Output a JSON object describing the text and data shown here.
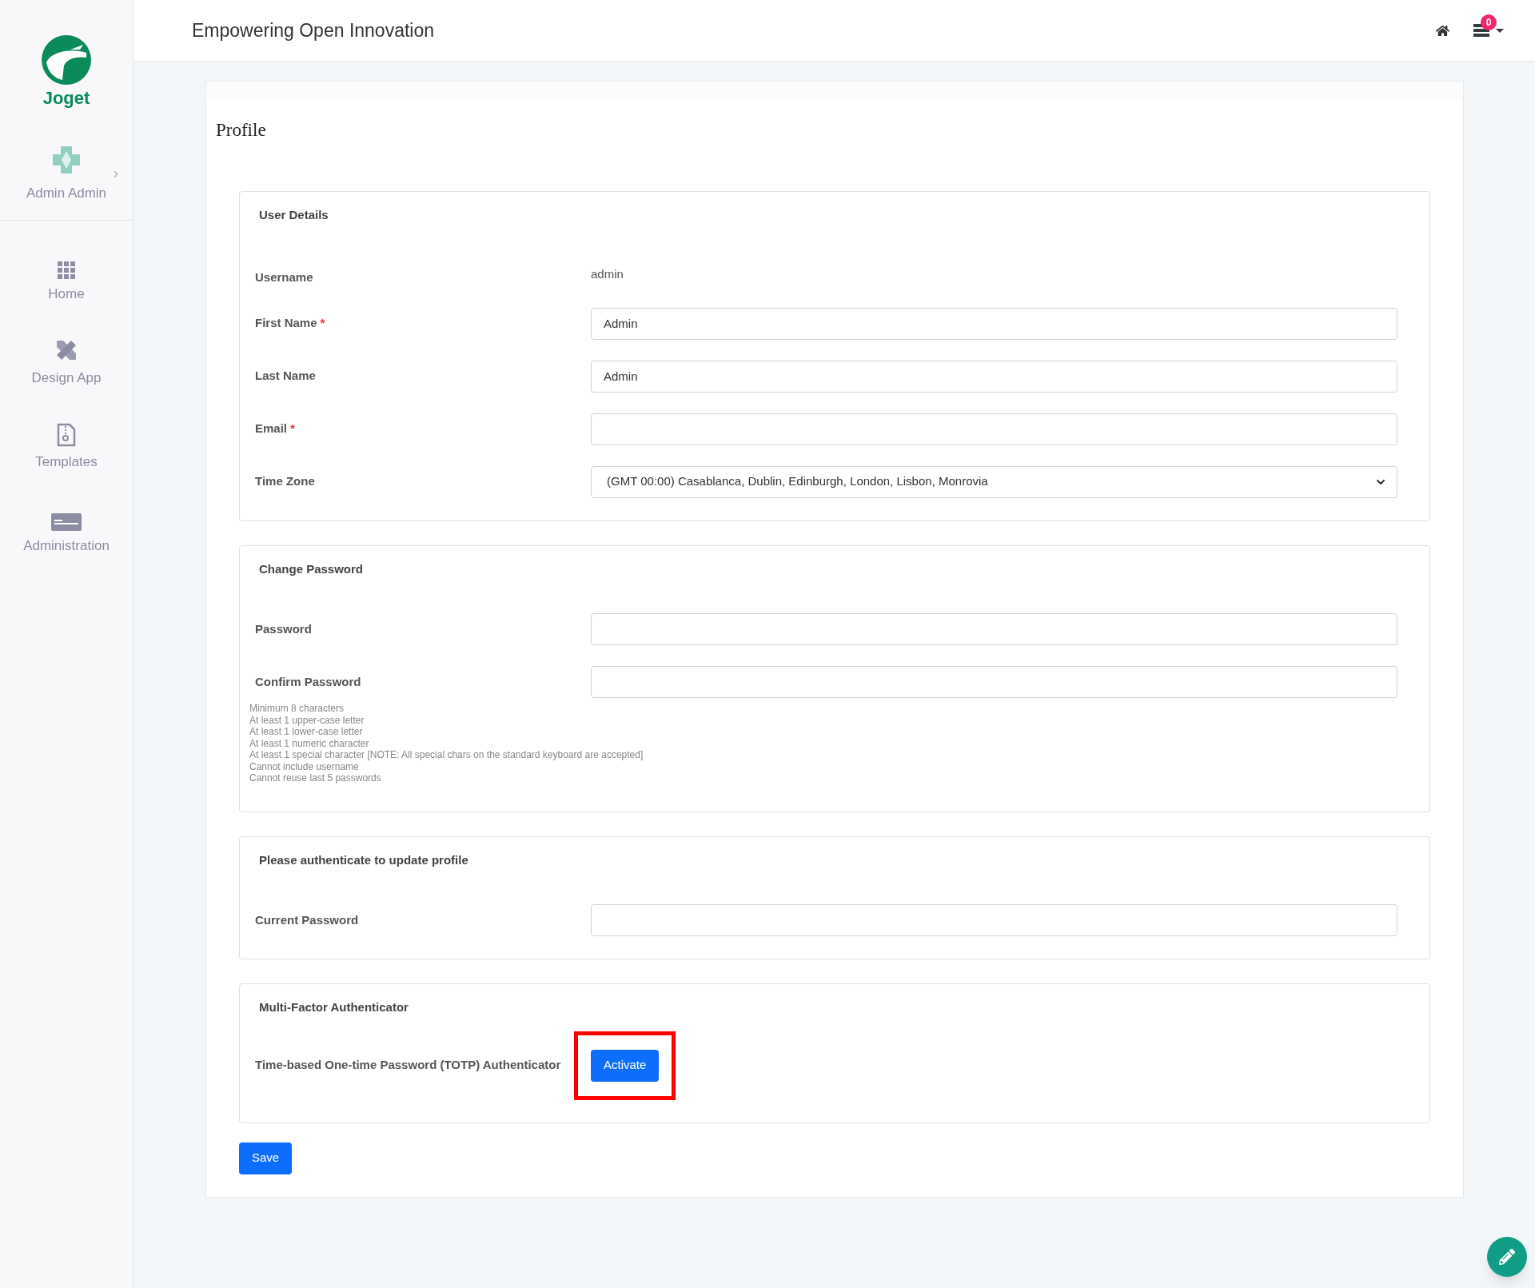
{
  "brand": {
    "name": "Joget"
  },
  "user": {
    "name": "Admin Admin"
  },
  "sidebar": {
    "items": [
      {
        "kind": "grid",
        "label": "Home"
      },
      {
        "kind": "design",
        "label": "Design App"
      },
      {
        "kind": "templates",
        "label": "Templates"
      },
      {
        "kind": "admin",
        "label": "Administration"
      }
    ]
  },
  "header": {
    "title": "Empowering Open Innovation",
    "notification_count": "0"
  },
  "page": {
    "title": "Profile"
  },
  "sections": [
    {
      "title": "User Details",
      "rows": [
        {
          "kind": "text",
          "label": "Username",
          "required": false,
          "value": "admin"
        },
        {
          "kind": "input",
          "label": "First Name",
          "required": true,
          "value": "Admin"
        },
        {
          "kind": "input",
          "label": "Last Name",
          "required": false,
          "value": "Admin"
        },
        {
          "kind": "input",
          "label": "Email",
          "required": true,
          "value": ""
        },
        {
          "kind": "select",
          "label": "Time Zone",
          "required": false,
          "value": "(GMT 00:00) Casablanca, Dublin, Edinburgh, London, Lisbon, Monrovia"
        }
      ]
    },
    {
      "title": "Change Password",
      "rows": [
        {
          "kind": "password",
          "label": "Password",
          "required": false,
          "value": ""
        },
        {
          "kind": "password",
          "label": "Confirm Password",
          "required": false,
          "value": ""
        }
      ],
      "hints": [
        "Minimum 8 characters",
        "At least 1 upper-case letter",
        "At least 1 lower-case letter",
        "At least 1 numeric character",
        "At least 1 special character [NOTE: All special chars on the standard keyboard are accepted]",
        "Cannot include username",
        "Cannot reuse last 5 passwords"
      ]
    },
    {
      "title": "Please authenticate to update profile",
      "rows": [
        {
          "kind": "password",
          "label": "Current Password",
          "required": false,
          "value": ""
        }
      ]
    },
    {
      "title": "Multi-Factor Authenticator",
      "rows": [
        {
          "kind": "button",
          "label": "Time-based One-time Password (TOTP) Authenticator",
          "required": false,
          "value": "Activate",
          "highlighted": true
        }
      ]
    }
  ],
  "required_mark": "*",
  "save_button": "Save"
}
